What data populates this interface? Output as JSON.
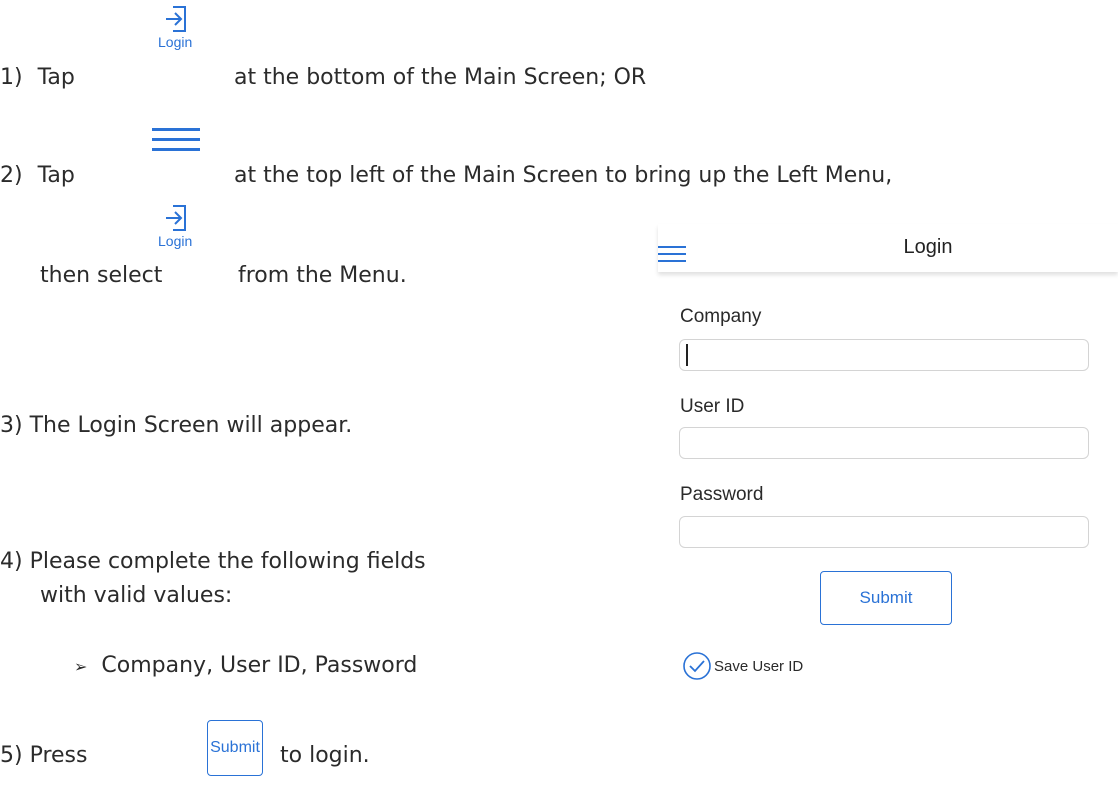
{
  "colors": {
    "accent": "#2a72d6",
    "text": "#2b2b2b"
  },
  "steps": {
    "s1": {
      "num": "1)",
      "pre": "Tap",
      "icon_label": "Login",
      "post": "at the bottom of the Main Screen; OR"
    },
    "s2": {
      "num": "2)",
      "pre": "Tap",
      "post": "at the top left of the Main Screen to bring up the Left Menu,"
    },
    "s2b": {
      "pre": "then select",
      "icon_label": "Login",
      "post": "from the Menu."
    },
    "s3": {
      "text": "3)  The Login Screen will appear."
    },
    "s4": {
      "line1": "4)  Please complete the following fields",
      "line2": "with valid values:",
      "bullet": "Company, User ID, Password"
    },
    "s5": {
      "pre": "5)  Press",
      "button": "Submit",
      "post": "to login."
    }
  },
  "login_screen": {
    "title": "Login",
    "company_label": "Company",
    "userid_label": "User ID",
    "password_label": "Password",
    "submit_label": "Submit",
    "save_label": "Save User ID"
  }
}
